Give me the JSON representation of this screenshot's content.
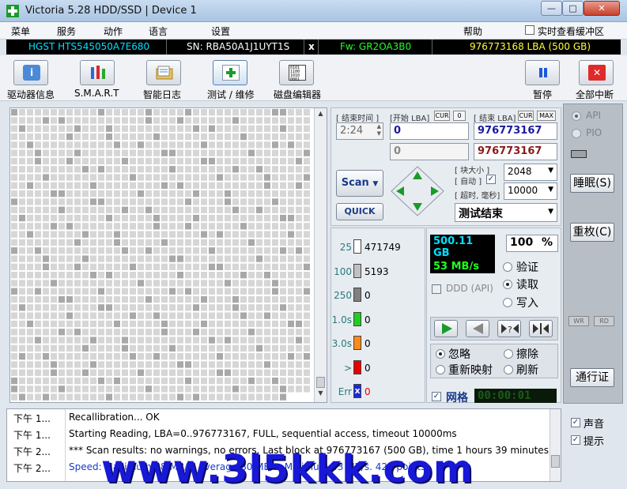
{
  "window": {
    "title": "Victoria 5.28 HDD/SSD | Device 1",
    "min": "—",
    "max": "□",
    "close": "✕"
  },
  "menu": {
    "items": [
      "菜单",
      "服务",
      "动作",
      "语言",
      "设置",
      "帮助"
    ],
    "buffer_label": "实时查看缓冲区"
  },
  "drive": {
    "model": "HGST HTS545050A7E680",
    "serial": "SN: RBA50A1J1UYT1S",
    "x": "x",
    "firmware": "Fw: GR2OA3B0",
    "lba": "976773168 LBA (500 GB)"
  },
  "toolbar": {
    "drive_info": "驱动器信息",
    "smart": "S.M.A.R.T",
    "smart_log": "智能日志",
    "test": "测试 / 维修",
    "disk_editor": "磁盘编辑器",
    "pause": "暂停",
    "abort": "全部中断"
  },
  "control": {
    "end_time_label": "[ 结束时间 ]",
    "end_time": "2:24",
    "start_lba_label": "[开始 LBA]",
    "cur": "CUR",
    "zero": "0",
    "end_lba_label": "[ 结束 LBA]",
    "max": "MAX",
    "start_lba": "0",
    "end_lba": "976773167",
    "start_lba_2": "0",
    "end_lba_2": "976773167",
    "scan_label": "Scan",
    "quick_label": "QUICK",
    "block_size_label": "[ 块大小 ]",
    "auto_label": "[ 自动 ]",
    "timeout_label": "[ 超时, 毫秒]",
    "block_size": "2048",
    "timeout": "10000",
    "status": "测试结束"
  },
  "stats": {
    "rows": [
      {
        "label": "25",
        "value": "471749",
        "color": "#ffffff"
      },
      {
        "label": "100",
        "value": "5193",
        "color": "#c0c0c0"
      },
      {
        "label": "250",
        "value": "0",
        "color": "#808080"
      },
      {
        "label": "1.0s",
        "value": "0",
        "color": "#22cc22"
      },
      {
        "label": "3.0s",
        "value": "0",
        "color": "#ff8a1a"
      },
      {
        "label": ">",
        "value": "0",
        "color": "#e80000"
      },
      {
        "label": "Err",
        "value": "0",
        "color": "#1a2ad8"
      }
    ],
    "err_glyph": "x"
  },
  "options": {
    "size": "500.11 GB",
    "percent": "100",
    "percent_sign": "%",
    "speed": "53 MB/s",
    "ddd": "DDD (API)",
    "verify": "验证",
    "read": "读取",
    "write": "写入",
    "ignore": "忽略",
    "erase": "擦除",
    "remap": "重新映射",
    "refresh": "刷新",
    "grid": "网格",
    "timer": "00:00:01"
  },
  "right": {
    "api": "API",
    "pio": "PIO",
    "sleep": "睡眠(S)",
    "reset": "重枚(C)",
    "wr": "WR",
    "rd": "RD",
    "passport": "通行证",
    "sound": "声音",
    "hints": "提示"
  },
  "log": [
    {
      "time": "下午 1...",
      "msg": "Recallibration... OK",
      "color": "#000000"
    },
    {
      "time": "下午 1...",
      "msg": "Starting Reading, LBA=0..976773167, FULL, sequential access, timeout 10000ms",
      "color": "#000000"
    },
    {
      "time": "下午 2...",
      "msg": "*** Scan results: no warnings, no errors. Last block at 976773167 (500 GB), time 1 hours 39 minutes...",
      "color": "#000000"
    },
    {
      "time": "下午 2...",
      "msg": "Speed: Maximum 98 MB/s. Average 80 MB/s. Minimum 43 MB/s. 423 points.",
      "color": "#1a3cc8"
    }
  ],
  "watermark": "www.3l5kkk.com",
  "colors": {
    "accent_cyan": "#00e0ff",
    "lcd_green": "#22ff22",
    "lba_red": "#8b1a1a",
    "lba_blue": "#1a1aa0"
  }
}
